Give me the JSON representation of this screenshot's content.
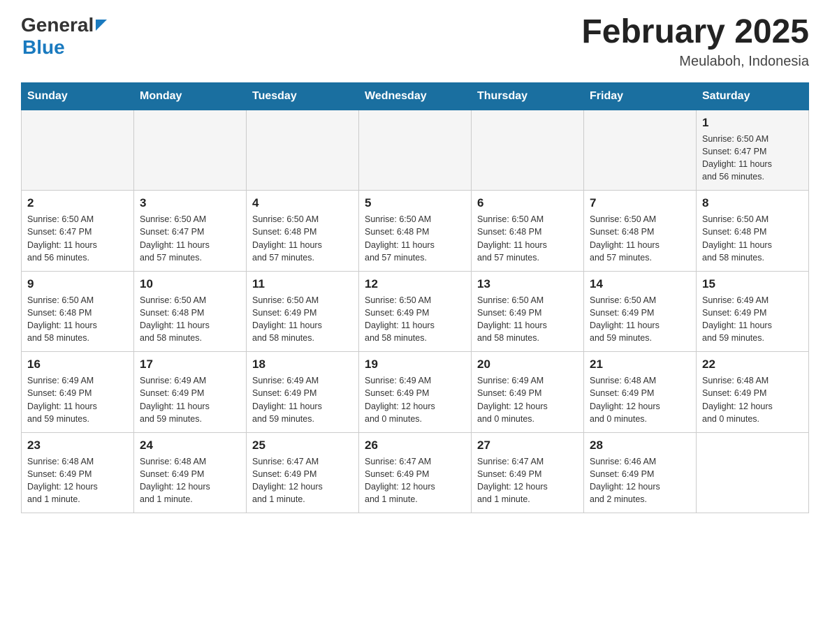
{
  "header": {
    "logo_general": "General",
    "logo_blue": "Blue",
    "title": "February 2025",
    "subtitle": "Meulaboh, Indonesia"
  },
  "days_of_week": [
    "Sunday",
    "Monday",
    "Tuesday",
    "Wednesday",
    "Thursday",
    "Friday",
    "Saturday"
  ],
  "weeks": [
    {
      "days": [
        {
          "number": "",
          "info": ""
        },
        {
          "number": "",
          "info": ""
        },
        {
          "number": "",
          "info": ""
        },
        {
          "number": "",
          "info": ""
        },
        {
          "number": "",
          "info": ""
        },
        {
          "number": "",
          "info": ""
        },
        {
          "number": "1",
          "info": "Sunrise: 6:50 AM\nSunset: 6:47 PM\nDaylight: 11 hours\nand 56 minutes."
        }
      ]
    },
    {
      "days": [
        {
          "number": "2",
          "info": "Sunrise: 6:50 AM\nSunset: 6:47 PM\nDaylight: 11 hours\nand 56 minutes."
        },
        {
          "number": "3",
          "info": "Sunrise: 6:50 AM\nSunset: 6:47 PM\nDaylight: 11 hours\nand 57 minutes."
        },
        {
          "number": "4",
          "info": "Sunrise: 6:50 AM\nSunset: 6:48 PM\nDaylight: 11 hours\nand 57 minutes."
        },
        {
          "number": "5",
          "info": "Sunrise: 6:50 AM\nSunset: 6:48 PM\nDaylight: 11 hours\nand 57 minutes."
        },
        {
          "number": "6",
          "info": "Sunrise: 6:50 AM\nSunset: 6:48 PM\nDaylight: 11 hours\nand 57 minutes."
        },
        {
          "number": "7",
          "info": "Sunrise: 6:50 AM\nSunset: 6:48 PM\nDaylight: 11 hours\nand 57 minutes."
        },
        {
          "number": "8",
          "info": "Sunrise: 6:50 AM\nSunset: 6:48 PM\nDaylight: 11 hours\nand 58 minutes."
        }
      ]
    },
    {
      "days": [
        {
          "number": "9",
          "info": "Sunrise: 6:50 AM\nSunset: 6:48 PM\nDaylight: 11 hours\nand 58 minutes."
        },
        {
          "number": "10",
          "info": "Sunrise: 6:50 AM\nSunset: 6:48 PM\nDaylight: 11 hours\nand 58 minutes."
        },
        {
          "number": "11",
          "info": "Sunrise: 6:50 AM\nSunset: 6:49 PM\nDaylight: 11 hours\nand 58 minutes."
        },
        {
          "number": "12",
          "info": "Sunrise: 6:50 AM\nSunset: 6:49 PM\nDaylight: 11 hours\nand 58 minutes."
        },
        {
          "number": "13",
          "info": "Sunrise: 6:50 AM\nSunset: 6:49 PM\nDaylight: 11 hours\nand 58 minutes."
        },
        {
          "number": "14",
          "info": "Sunrise: 6:50 AM\nSunset: 6:49 PM\nDaylight: 11 hours\nand 59 minutes."
        },
        {
          "number": "15",
          "info": "Sunrise: 6:49 AM\nSunset: 6:49 PM\nDaylight: 11 hours\nand 59 minutes."
        }
      ]
    },
    {
      "days": [
        {
          "number": "16",
          "info": "Sunrise: 6:49 AM\nSunset: 6:49 PM\nDaylight: 11 hours\nand 59 minutes."
        },
        {
          "number": "17",
          "info": "Sunrise: 6:49 AM\nSunset: 6:49 PM\nDaylight: 11 hours\nand 59 minutes."
        },
        {
          "number": "18",
          "info": "Sunrise: 6:49 AM\nSunset: 6:49 PM\nDaylight: 11 hours\nand 59 minutes."
        },
        {
          "number": "19",
          "info": "Sunrise: 6:49 AM\nSunset: 6:49 PM\nDaylight: 12 hours\nand 0 minutes."
        },
        {
          "number": "20",
          "info": "Sunrise: 6:49 AM\nSunset: 6:49 PM\nDaylight: 12 hours\nand 0 minutes."
        },
        {
          "number": "21",
          "info": "Sunrise: 6:48 AM\nSunset: 6:49 PM\nDaylight: 12 hours\nand 0 minutes."
        },
        {
          "number": "22",
          "info": "Sunrise: 6:48 AM\nSunset: 6:49 PM\nDaylight: 12 hours\nand 0 minutes."
        }
      ]
    },
    {
      "days": [
        {
          "number": "23",
          "info": "Sunrise: 6:48 AM\nSunset: 6:49 PM\nDaylight: 12 hours\nand 1 minute."
        },
        {
          "number": "24",
          "info": "Sunrise: 6:48 AM\nSunset: 6:49 PM\nDaylight: 12 hours\nand 1 minute."
        },
        {
          "number": "25",
          "info": "Sunrise: 6:47 AM\nSunset: 6:49 PM\nDaylight: 12 hours\nand 1 minute."
        },
        {
          "number": "26",
          "info": "Sunrise: 6:47 AM\nSunset: 6:49 PM\nDaylight: 12 hours\nand 1 minute."
        },
        {
          "number": "27",
          "info": "Sunrise: 6:47 AM\nSunset: 6:49 PM\nDaylight: 12 hours\nand 1 minute."
        },
        {
          "number": "28",
          "info": "Sunrise: 6:46 AM\nSunset: 6:49 PM\nDaylight: 12 hours\nand 2 minutes."
        },
        {
          "number": "",
          "info": ""
        }
      ]
    }
  ]
}
